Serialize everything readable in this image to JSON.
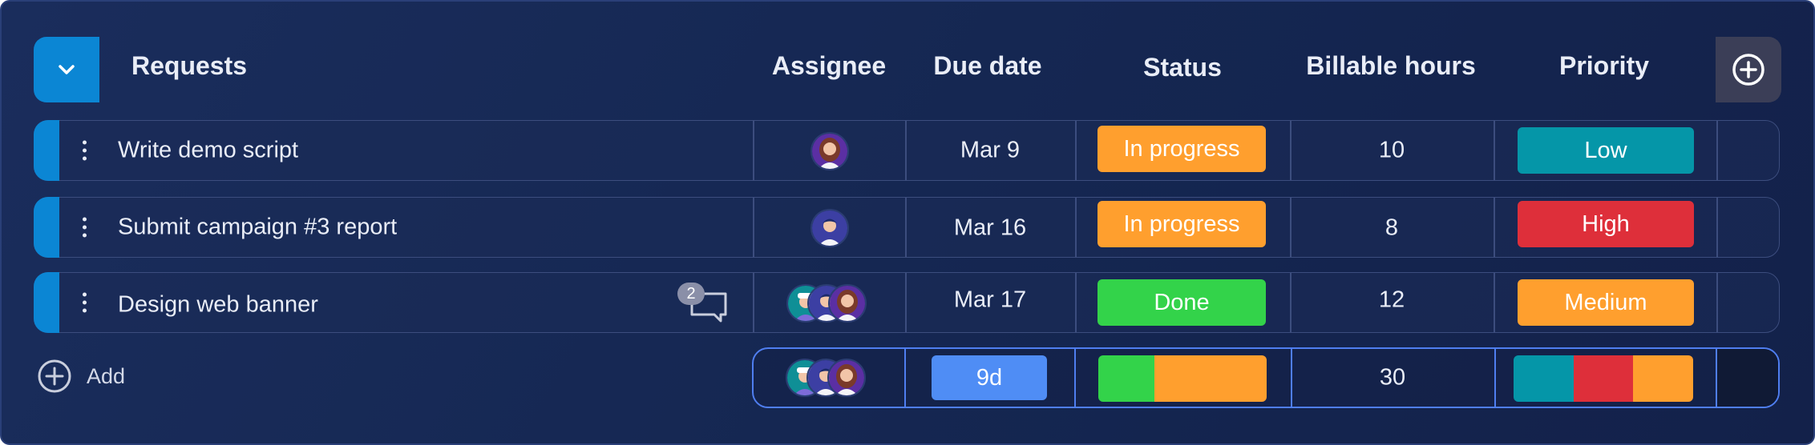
{
  "header": {
    "title": "Requests",
    "columns": {
      "assignee": "Assignee",
      "due_date": "Due date",
      "status": "Status",
      "billable_hours": "Billable hours",
      "priority": "Priority"
    }
  },
  "rows": [
    {
      "name": "Write demo script",
      "assignees": [
        "avatar-woman-purple"
      ],
      "due": "Mar 9",
      "status": {
        "label": "In progress",
        "color": "#ff9f2e"
      },
      "hours": "10",
      "priority": {
        "label": "Low",
        "color": "#0596a8"
      },
      "comments": null
    },
    {
      "name": "Submit campaign #3 report",
      "assignees": [
        "avatar-man-blue"
      ],
      "due": "Mar 16",
      "status": {
        "label": "In progress",
        "color": "#ff9f2e"
      },
      "hours": "8",
      "priority": {
        "label": "High",
        "color": "#de2f3a"
      },
      "comments": null
    },
    {
      "name": "Design web banner",
      "assignees": [
        "avatar-man-teal",
        "avatar-man-blue",
        "avatar-woman-purple"
      ],
      "due": "Mar 17",
      "status": {
        "label": "Done",
        "color": "#33d34a"
      },
      "hours": "12",
      "priority": {
        "label": "Medium",
        "color": "#ff9f2e"
      },
      "comments": "2"
    }
  ],
  "summary": {
    "add_label": "Add",
    "due_span": "9d",
    "hours_total": "30",
    "status_mix": [
      {
        "color": "#33d34a",
        "fraction": 0.3333
      },
      {
        "color": "#ff9f2e",
        "fraction": 0.6667
      }
    ],
    "priority_mix": [
      {
        "color": "#0596a8",
        "fraction": 0.3333
      },
      {
        "color": "#de2f3a",
        "fraction": 0.3333
      },
      {
        "color": "#ff9f2e",
        "fraction": 0.3334
      }
    ]
  },
  "colors": {
    "accent_blue": "#0b86d4",
    "summary_border": "#4f7ef0",
    "due_pill": "#4f8df5"
  }
}
